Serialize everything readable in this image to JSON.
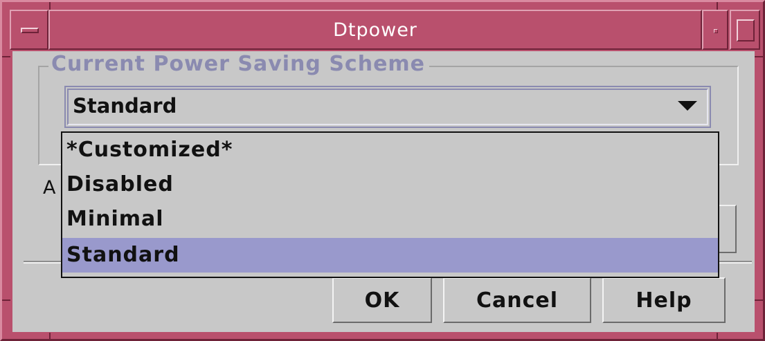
{
  "window": {
    "title": "Dtpower"
  },
  "group": {
    "legend": "Current Power Saving Scheme"
  },
  "combo": {
    "value": "Standard",
    "options": [
      "*Customized*",
      "Disabled",
      "Minimal",
      "Standard"
    ],
    "selected_index": 3
  },
  "partial_label": "A",
  "buttons": {
    "ok": "OK",
    "cancel": "Cancel",
    "help": "Help"
  },
  "colors": {
    "titlebar": "#b9506d",
    "background": "#c8c8c8",
    "selection": "#9999cc",
    "legend_text": "#8a8ab0"
  }
}
